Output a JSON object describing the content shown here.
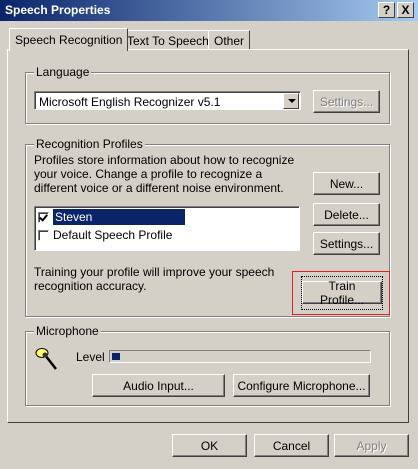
{
  "window": {
    "title": "Speech Properties",
    "help_label": "?",
    "close_label": "X"
  },
  "tabs": [
    {
      "label": "Speech Recognition",
      "active": true
    },
    {
      "label": "Text To Speech",
      "active": false
    },
    {
      "label": "Other",
      "active": false
    }
  ],
  "language": {
    "group_title": "Language",
    "selected_engine": "Microsoft English Recognizer v5.1",
    "settings_label": "Settings..."
  },
  "profiles": {
    "group_title": "Recognition Profiles",
    "description": "Profiles store information about how to recognize your voice.  Change a profile to recognize a different voice or a different noise environment.",
    "items": [
      {
        "label": "Steven",
        "checked": true,
        "selected": true
      },
      {
        "label": "Default Speech Profile",
        "checked": false,
        "selected": false
      }
    ],
    "new_label": "New...",
    "delete_label": "Delete...",
    "settings_label": "Settings...",
    "training_text": "Training your profile will improve your speech recognition accuracy.",
    "train_label": "Train Profile..."
  },
  "microphone": {
    "group_title": "Microphone",
    "level_label": "Level",
    "level_fraction": 0.03,
    "audio_input_label": "Audio Input...",
    "configure_label": "Configure Microphone..."
  },
  "footer": {
    "ok_label": "OK",
    "cancel_label": "Cancel",
    "apply_label": "Apply"
  },
  "colors": {
    "highlight": "#e02020",
    "selection": "#0a246a"
  }
}
